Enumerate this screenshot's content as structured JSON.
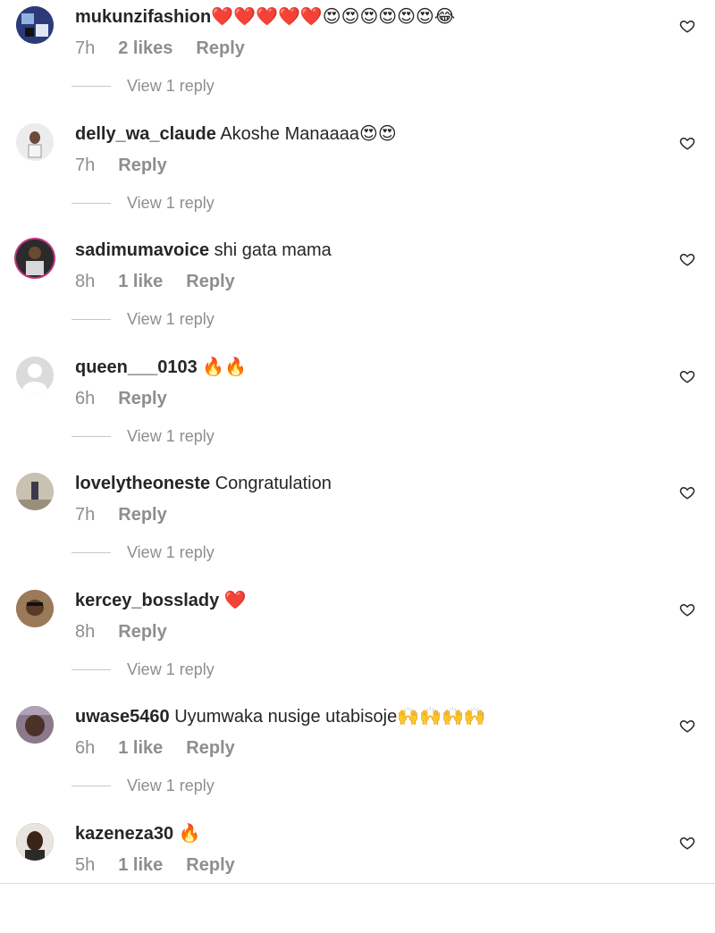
{
  "comments": [
    {
      "username": "mukunzifashion",
      "text": "❤️❤️❤️❤️❤️😍😍😍😍😍😍😂",
      "time": "7h",
      "likes": "2 likes",
      "reply": "Reply",
      "view_replies": "View 1 reply",
      "avatar_icon": "profile-photo"
    },
    {
      "username": "delly_wa_claude",
      "text": " Akoshe Manaaaa😍😍",
      "time": "7h",
      "likes": "",
      "reply": "Reply",
      "view_replies": "View 1 reply",
      "avatar_icon": "profile-photo"
    },
    {
      "username": "sadimumavoice",
      "text": " shi gata mama",
      "time": "8h",
      "likes": "1 like",
      "reply": "Reply",
      "view_replies": "View 1 reply",
      "avatar_icon": "profile-photo-story-ring"
    },
    {
      "username": "queen___0103",
      "text": " 🔥🔥",
      "time": "6h",
      "likes": "",
      "reply": "Reply",
      "view_replies": "View 1 reply",
      "avatar_icon": "default-avatar"
    },
    {
      "username": "lovelytheoneste",
      "text": " Congratulation",
      "time": "7h",
      "likes": "",
      "reply": "Reply",
      "view_replies": "View 1 reply",
      "avatar_icon": "profile-photo"
    },
    {
      "username": "kercey_bosslady",
      "text": " ❤️",
      "time": "8h",
      "likes": "",
      "reply": "Reply",
      "view_replies": "View 1 reply",
      "avatar_icon": "profile-photo"
    },
    {
      "username": "uwase5460",
      "text": " Uyumwaka nusige utabisoje🙌🙌🙌🙌",
      "time": "6h",
      "likes": "1 like",
      "reply": "Reply",
      "view_replies": "View 1 reply",
      "avatar_icon": "profile-photo"
    },
    {
      "username": "kazeneza30",
      "text": " 🔥",
      "time": "5h",
      "likes": "1 like",
      "reply": "Reply",
      "view_replies": "",
      "avatar_icon": "profile-photo"
    }
  ],
  "icons": {
    "like": "heart-outline-icon"
  },
  "colors": {
    "username": "#262626",
    "meta": "#8e8e8e",
    "story_ring": "#c13584",
    "heart_outline": "#262626"
  }
}
